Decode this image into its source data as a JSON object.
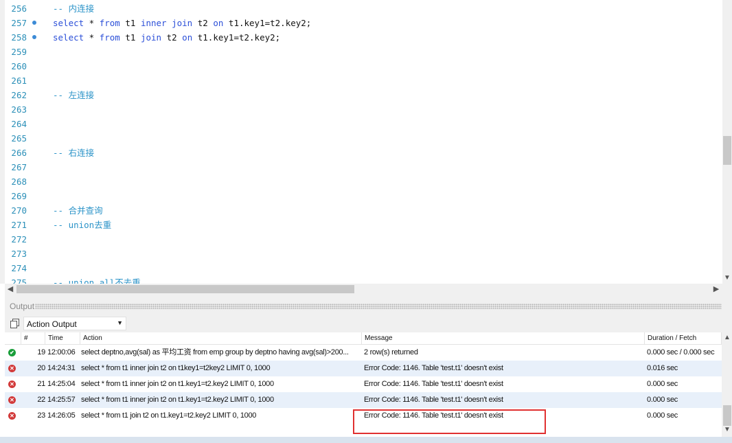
{
  "editor": {
    "lines": [
      {
        "num": "256",
        "bp": false,
        "tokens": [
          {
            "t": "-- 内连接",
            "c": "cm"
          }
        ]
      },
      {
        "num": "257",
        "bp": true,
        "tokens": [
          {
            "t": "select",
            "c": "kw"
          },
          {
            "t": " * ",
            "c": "tx"
          },
          {
            "t": "from",
            "c": "kw"
          },
          {
            "t": " t1 ",
            "c": "tx"
          },
          {
            "t": "inner join",
            "c": "kw"
          },
          {
            "t": " t2 ",
            "c": "tx"
          },
          {
            "t": "on",
            "c": "kw"
          },
          {
            "t": " t1.key1=t2.key2;",
            "c": "tx"
          }
        ]
      },
      {
        "num": "258",
        "bp": true,
        "tokens": [
          {
            "t": "select",
            "c": "kw"
          },
          {
            "t": " * ",
            "c": "tx"
          },
          {
            "t": "from",
            "c": "kw"
          },
          {
            "t": " t1 ",
            "c": "tx"
          },
          {
            "t": "join",
            "c": "kw"
          },
          {
            "t": " t2 ",
            "c": "tx"
          },
          {
            "t": "on",
            "c": "kw"
          },
          {
            "t": " t1.key1=t2.key2;",
            "c": "tx"
          }
        ]
      },
      {
        "num": "259",
        "bp": false,
        "tokens": []
      },
      {
        "num": "260",
        "bp": false,
        "tokens": []
      },
      {
        "num": "261",
        "bp": false,
        "tokens": []
      },
      {
        "num": "262",
        "bp": false,
        "tokens": [
          {
            "t": "-- 左连接",
            "c": "cm"
          }
        ]
      },
      {
        "num": "263",
        "bp": false,
        "tokens": []
      },
      {
        "num": "264",
        "bp": false,
        "tokens": []
      },
      {
        "num": "265",
        "bp": false,
        "tokens": []
      },
      {
        "num": "266",
        "bp": false,
        "tokens": [
          {
            "t": "-- 右连接",
            "c": "cm"
          }
        ]
      },
      {
        "num": "267",
        "bp": false,
        "tokens": []
      },
      {
        "num": "268",
        "bp": false,
        "tokens": []
      },
      {
        "num": "269",
        "bp": false,
        "tokens": []
      },
      {
        "num": "270",
        "bp": false,
        "tokens": [
          {
            "t": "-- 合并查询",
            "c": "cm"
          }
        ]
      },
      {
        "num": "271",
        "bp": false,
        "tokens": [
          {
            "t": "-- union去重",
            "c": "cm"
          }
        ]
      },
      {
        "num": "272",
        "bp": false,
        "tokens": []
      },
      {
        "num": "273",
        "bp": false,
        "tokens": []
      },
      {
        "num": "274",
        "bp": false,
        "tokens": []
      },
      {
        "num": "275",
        "bp": false,
        "tokens": [
          {
            "t": "-- union all不去重",
            "c": "cm"
          }
        ]
      }
    ]
  },
  "output": {
    "title": "Output",
    "selector": "Action Output",
    "columns": [
      "#",
      "Time",
      "Action",
      "Message",
      "Duration / Fetch"
    ],
    "rows": [
      {
        "status": "ok",
        "num": "19",
        "time": "12:00:06",
        "action": "select deptno,avg(sal) as 平均工资 from emp group by deptno having avg(sal)>200...",
        "message": "2 row(s) returned",
        "duration": "0.000 sec / 0.000 sec"
      },
      {
        "status": "err",
        "num": "20",
        "time": "14:24:31",
        "action": "select * from t1 inner join t2 on  t1key1=t2key2 LIMIT 0, 1000",
        "message": "Error Code: 1146. Table 'test.t1' doesn't exist",
        "duration": "0.016 sec"
      },
      {
        "status": "err",
        "num": "21",
        "time": "14:25:04",
        "action": "select * from t1 inner join t2 on  t1.key1=t2.key2 LIMIT 0, 1000",
        "message": "Error Code: 1146. Table 'test.t1' doesn't exist",
        "duration": "0.000 sec"
      },
      {
        "status": "err",
        "num": "22",
        "time": "14:25:57",
        "action": "select * from t1 inner join t2 on t1.key1=t2.key2 LIMIT 0, 1000",
        "message": "Error Code: 1146. Table 'test.t1' doesn't exist",
        "duration": "0.000 sec"
      },
      {
        "status": "err",
        "num": "23",
        "time": "14:26:05",
        "action": "select * from t1 join t2 on t1.key1=t2.key2 LIMIT 0, 1000",
        "message": "Error Code: 1146. Table 'test.t1' doesn't exist",
        "duration": "0.000 sec"
      }
    ]
  },
  "colors": {
    "keyword": "#2b4fd8",
    "comment": "#2a93c8",
    "line_number": "#2b8fb8",
    "error": "#d23a3a",
    "success": "#1a9e3a",
    "highlight_box": "#e03030",
    "alt_row": "#e8f0fa"
  },
  "icons": {
    "copy": "copy-icon",
    "ok": "check-circle-icon",
    "err": "error-circle-icon"
  }
}
